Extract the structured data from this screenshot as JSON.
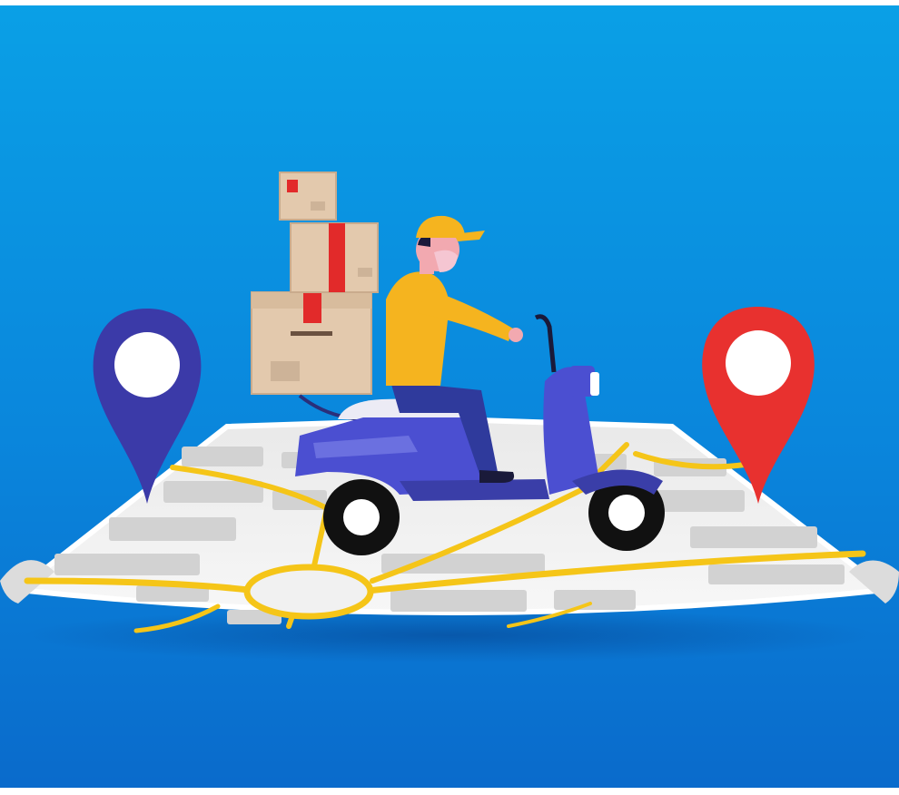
{
  "illustration": {
    "subject": "delivery-scooter-on-map",
    "icons": [
      "map-pin-icon",
      "map-pin-icon",
      "scooter-icon",
      "package-box-icon",
      "courier-icon",
      "map-icon"
    ],
    "colors": {
      "background_top": "#0aa0e6",
      "background_bottom": "#0a6fd0",
      "map_paper": "#f1f1f1",
      "map_block": "#d4d4d4",
      "road": "#f5c518",
      "pin_left": "#3b3aa8",
      "pin_right": "#e8312f",
      "scooter_body": "#4b4fd1",
      "courier_shirt": "#f5b41f",
      "courier_pants": "#2f3a9c",
      "box": "#e3c9ad",
      "box_tape": "#e22a2a"
    }
  }
}
